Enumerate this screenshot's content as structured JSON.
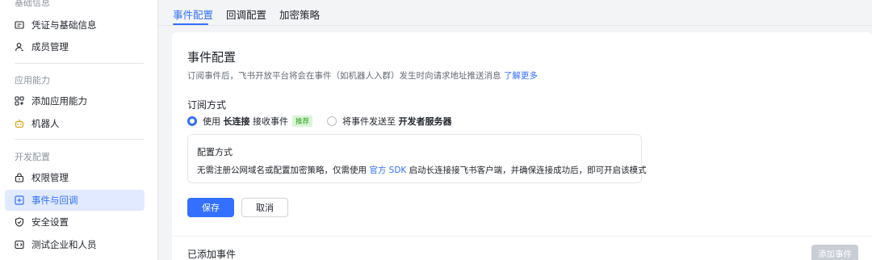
{
  "sidebar": {
    "group_basic": "基础信息",
    "credentials": "凭证与基础信息",
    "members": "成员管理",
    "group_capability": "应用能力",
    "add_capability": "添加应用能力",
    "bot": "机器人",
    "group_dev": "开发配置",
    "permissions": "权限管理",
    "events": "事件与回调",
    "security": "安全设置",
    "test_users": "测试企业和人员"
  },
  "tabs": {
    "event_config": "事件配置",
    "callback_config": "回调配置",
    "encryption": "加密策略"
  },
  "main": {
    "title": "事件配置",
    "desc": "订阅事件后，飞书开放平台将会在事件（如机器人入群）发生时向请求地址推送消息",
    "learn_more": "了解更多",
    "subscribe_title": "订阅方式",
    "option1_pre": "使用",
    "option1_bold": "长连接",
    "option1_post": "接收事件",
    "recommend_badge": "推荐",
    "option2_pre": "将事件发送至",
    "option2_bold": "开发者服务器",
    "config_title": "配置方式",
    "config_text_pre": "无需注册公网域名或配置加密策略，仅需使用",
    "config_link": "官方 SDK",
    "config_text_post": "启动长连接接飞书客户端，并确保连接成功后，即可开启该模式",
    "save": "保存",
    "cancel": "取消",
    "added_events": "已添加事件",
    "add_event": "添加事件"
  },
  "colors": {
    "accent": "#3370ff",
    "active_bg": "#e1eaff",
    "badge_bg": "#d9f5d6",
    "badge_text": "#2ea121",
    "disabled": "#c9cdd4"
  },
  "icons": {
    "credentials": "id-card-icon",
    "members": "user-icon",
    "add_capability": "grid-plus-icon",
    "bot": "robot-icon",
    "permissions": "lock-icon",
    "events": "event-icon",
    "security": "shield-icon",
    "test_users": "code-box-icon"
  }
}
